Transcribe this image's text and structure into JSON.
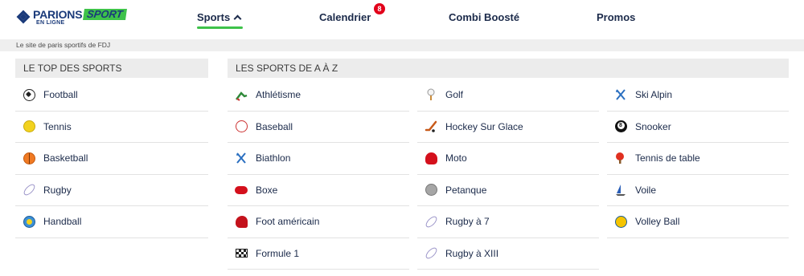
{
  "header": {
    "logo": {
      "brand": "PARIONS",
      "sport": "SPORT",
      "sub": "EN LIGNE"
    },
    "nav": {
      "sports": "Sports",
      "calendrier": "Calendrier",
      "calendrier_badge": "8",
      "combi": "Combi Boosté",
      "promos": "Promos"
    }
  },
  "subbar": {
    "text": "Le site de paris sportifs de FDJ"
  },
  "top": {
    "title": "LE TOP DES SPORTS",
    "items": [
      {
        "label": "Football",
        "icon": "football-icon"
      },
      {
        "label": "Tennis",
        "icon": "tennis-ball-icon"
      },
      {
        "label": "Basketball",
        "icon": "basketball-icon"
      },
      {
        "label": "Rugby",
        "icon": "rugby-ball-icon"
      },
      {
        "label": "Handball",
        "icon": "handball-icon"
      }
    ]
  },
  "az": {
    "title": "LES SPORTS DE A À Z",
    "col_a": [
      {
        "label": "Athlétisme",
        "icon": "athletics-icon"
      },
      {
        "label": "Baseball",
        "icon": "baseball-icon"
      },
      {
        "label": "Biathlon",
        "icon": "biathlon-icon"
      },
      {
        "label": "Boxe",
        "icon": "boxing-glove-icon"
      },
      {
        "label": "Foot américain",
        "icon": "football-helmet-icon"
      },
      {
        "label": "Formule 1",
        "icon": "checkered-flag-icon"
      }
    ],
    "col_b": [
      {
        "label": "Golf",
        "icon": "golf-icon"
      },
      {
        "label": "Hockey Sur Glace",
        "icon": "hockey-stick-icon"
      },
      {
        "label": "Moto",
        "icon": "motorcycle-helmet-icon"
      },
      {
        "label": "Petanque",
        "icon": "petanque-ball-icon"
      },
      {
        "label": "Rugby à 7",
        "icon": "rugby-seven-icon"
      },
      {
        "label": "Rugby à XIII",
        "icon": "rugby-thirteen-icon"
      }
    ],
    "col_c": [
      {
        "label": "Ski Alpin",
        "icon": "ski-icon"
      },
      {
        "label": "Snooker",
        "icon": "snooker-ball-icon"
      },
      {
        "label": "Tennis de table",
        "icon": "ping-pong-icon"
      },
      {
        "label": "Voile",
        "icon": "sailboat-icon"
      },
      {
        "label": "Volley Ball",
        "icon": "volleyball-icon"
      }
    ]
  },
  "colors": {
    "brand_blue": "#1a3a7a",
    "brand_green": "#3ec24a",
    "badge_red": "#e2001a"
  }
}
